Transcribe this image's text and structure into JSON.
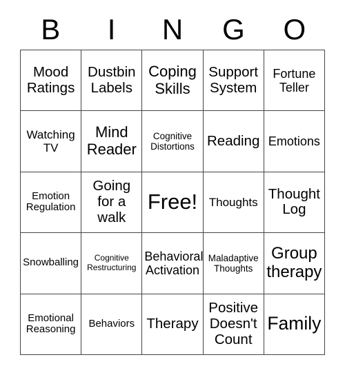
{
  "card": {
    "type": "bingo-card",
    "header_letters": [
      "B",
      "I",
      "N",
      "G",
      "O"
    ],
    "columns": 5,
    "rows": 5,
    "background_color": "#ffffff",
    "text_color": "#000000",
    "border_color": "#444444",
    "free_space_label": "Free!",
    "free_space_position": {
      "row": 3,
      "column": 3
    }
  },
  "cells": [
    {
      "text": "Mood\nRatings",
      "size": "fs-l"
    },
    {
      "text": "Dustbin\nLabels",
      "size": "fs-l"
    },
    {
      "text": "Coping\nSkills",
      "size": "fs-xl"
    },
    {
      "text": "Support\nSystem",
      "size": "fs-l"
    },
    {
      "text": "Fortune\nTeller",
      "size": "fs-ml"
    },
    {
      "text": "Watching\nTV",
      "size": "fs-m"
    },
    {
      "text": "Mind\nReader",
      "size": "fs-xl"
    },
    {
      "text": "Cognitive\nDistortions",
      "size": "fs-sm"
    },
    {
      "text": "Reading",
      "size": "fs-l"
    },
    {
      "text": "Emotions",
      "size": "fs-ml"
    },
    {
      "text": "Emotion\nRegulation",
      "size": "fs-s"
    },
    {
      "text": "Going\nfor a\nwalk",
      "size": "fs-l"
    },
    {
      "text": "Free!",
      "size": "fs-free"
    },
    {
      "text": "Thoughts",
      "size": "fs-m"
    },
    {
      "text": "Thought\nLog",
      "size": "fs-l"
    },
    {
      "text": "Snowballing",
      "size": "fs-s"
    },
    {
      "text": "Cognitive\nRestructuring",
      "size": "fs-xs"
    },
    {
      "text": "Behavioral\nActivation",
      "size": "fs-ml"
    },
    {
      "text": "Maladaptive\nThoughts",
      "size": "fs-sm"
    },
    {
      "text": "Group\ntherapy",
      "size": "fs-xxl"
    },
    {
      "text": "Emotional\nReasoning",
      "size": "fs-s"
    },
    {
      "text": "Behaviors",
      "size": "fs-s"
    },
    {
      "text": "Therapy",
      "size": "fs-l"
    },
    {
      "text": "Positive\nDoesn't\nCount",
      "size": "fs-l"
    },
    {
      "text": "Family",
      "size": "fs-huge"
    }
  ]
}
